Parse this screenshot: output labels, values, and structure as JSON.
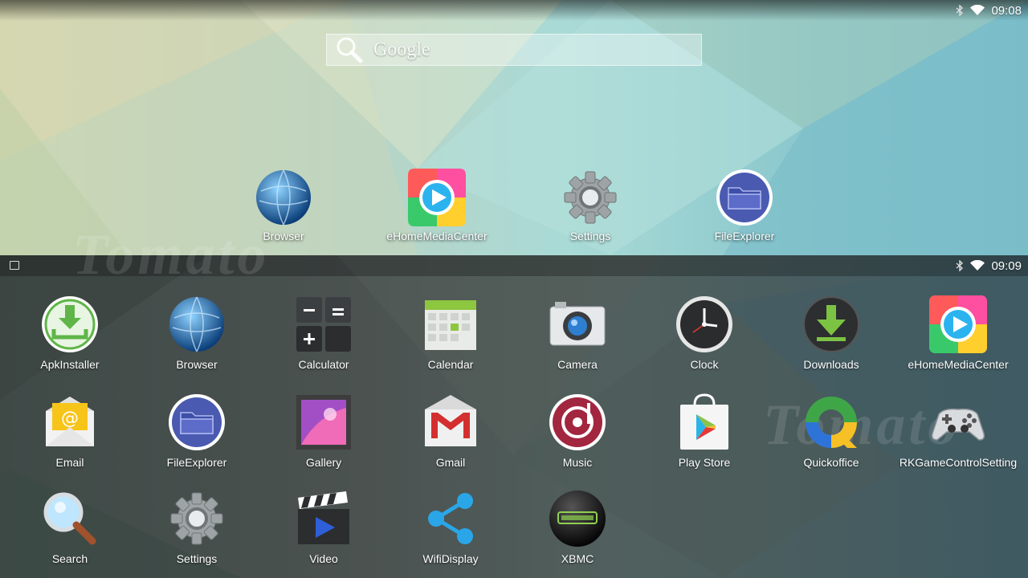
{
  "home": {
    "status_time": "09:08",
    "search_label": "Google",
    "watermark": "Tomato",
    "dock": [
      {
        "label": "Browser"
      },
      {
        "label": "eHomeMediaCenter"
      },
      {
        "label": "Settings"
      },
      {
        "label": "FileExplorer"
      }
    ]
  },
  "drawer": {
    "status_time": "09:09",
    "watermark": "Tomato",
    "apps": [
      {
        "label": "ApkInstaller"
      },
      {
        "label": "Browser"
      },
      {
        "label": "Calculator"
      },
      {
        "label": "Calendar"
      },
      {
        "label": "Camera"
      },
      {
        "label": "Clock"
      },
      {
        "label": "Downloads"
      },
      {
        "label": "eHomeMediaCenter"
      },
      {
        "label": "Email"
      },
      {
        "label": "FileExplorer"
      },
      {
        "label": "Gallery"
      },
      {
        "label": "Gmail"
      },
      {
        "label": "Music"
      },
      {
        "label": "Play Store"
      },
      {
        "label": "Quickoffice"
      },
      {
        "label": "RKGameControlSetting"
      },
      {
        "label": "Search"
      },
      {
        "label": "Settings"
      },
      {
        "label": "Video"
      },
      {
        "label": "WifiDisplay"
      },
      {
        "label": "XBMC"
      }
    ]
  }
}
